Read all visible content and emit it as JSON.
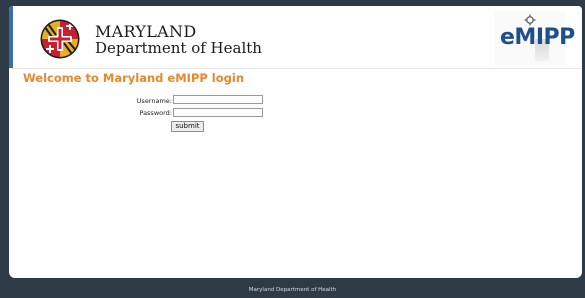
{
  "header": {
    "org_line1": "MARYLAND",
    "org_line2": "Department of Health",
    "app_logo_text": "eMIPP",
    "logo_icon": "maryland-flag-seal-icon"
  },
  "main": {
    "welcome_title": "Welcome to Maryland eMIPP login"
  },
  "login_form": {
    "username_label": "Username:",
    "username_value": "",
    "password_label": "Password:",
    "password_value": "",
    "submit_label": "submit"
  },
  "footer": {
    "text": "Maryland Department of Health"
  },
  "colors": {
    "page_background": "#2e3a46",
    "title_orange": "#e8882d",
    "brand_blue": "#1f4e8c"
  }
}
